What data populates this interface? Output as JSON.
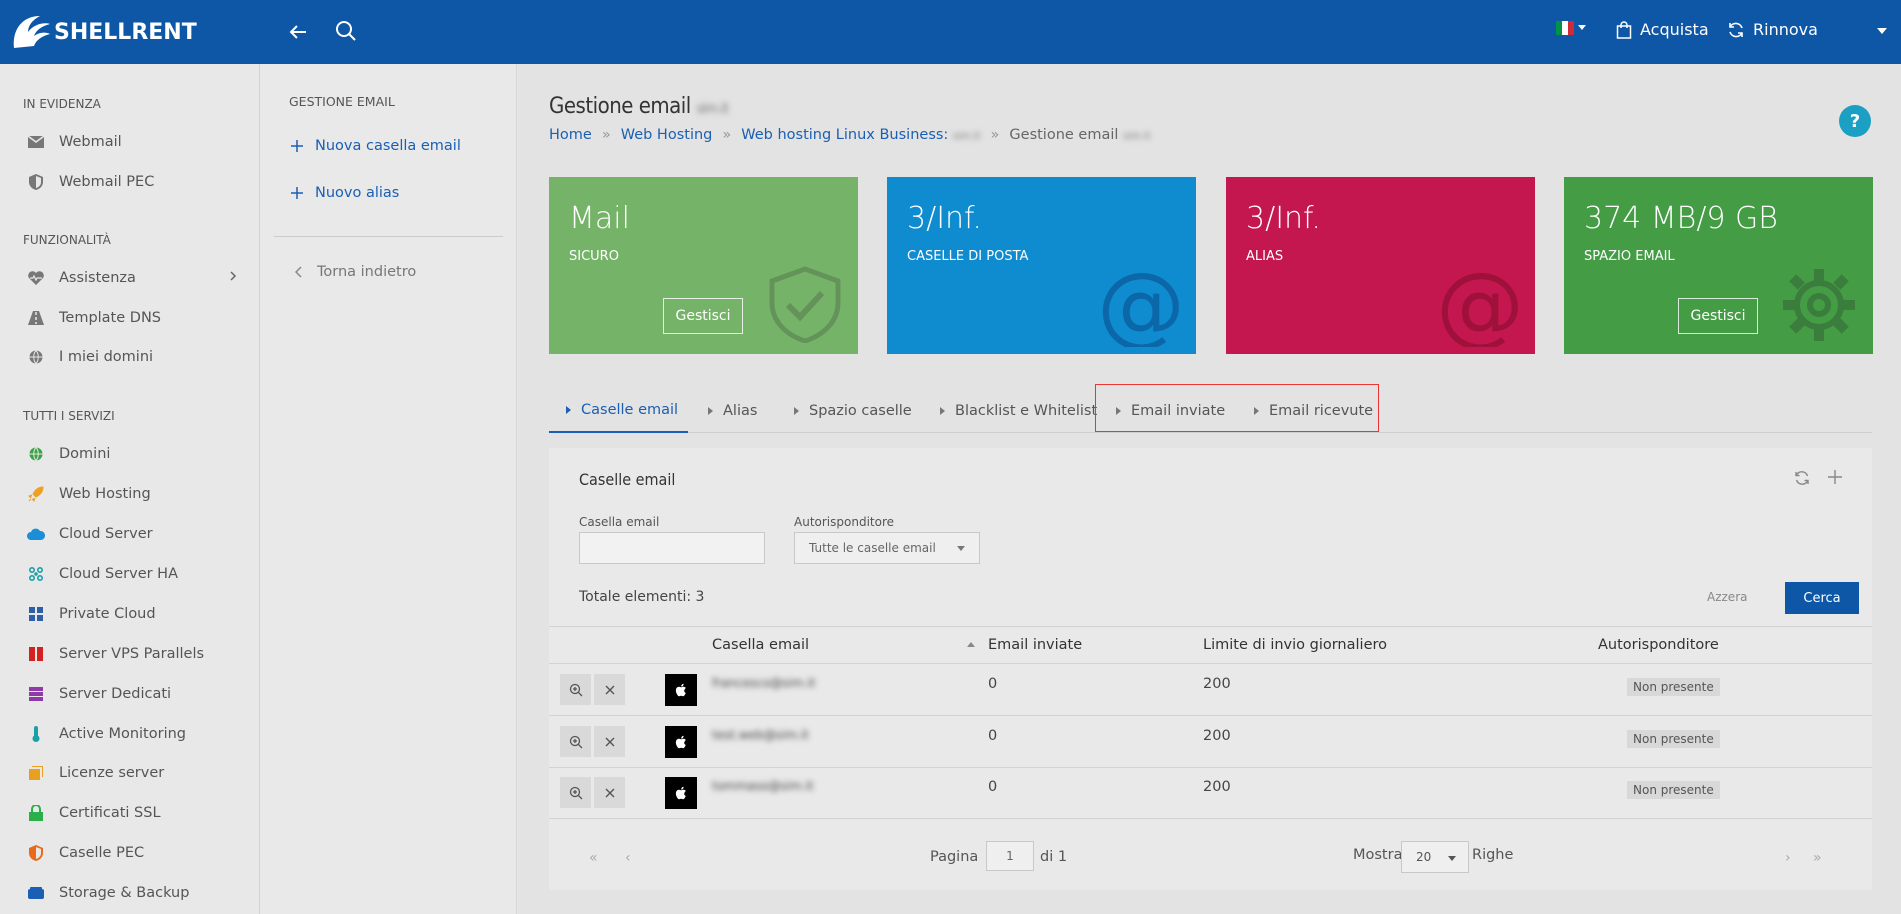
{
  "topbar": {
    "logo_text": "SHELLRENT",
    "acquista_label": "Acquista",
    "rinnova_label": "Rinnova"
  },
  "sidebar": {
    "sections": [
      {
        "title": "IN EVIDENZA"
      },
      {
        "title": "FUNZIONALITÀ"
      },
      {
        "title": "TUTTI I SERVIZI"
      }
    ],
    "items": [
      {
        "label": "Webmail",
        "icon": "envelope-icon"
      },
      {
        "label": "Webmail PEC",
        "icon": "shield-icon"
      },
      {
        "label": "Assistenza",
        "icon": "heart-pulse-icon"
      },
      {
        "label": "Template DNS",
        "icon": "road-icon"
      },
      {
        "label": "I miei domini",
        "icon": "globe-icon"
      },
      {
        "label": "Domini",
        "icon": "globe-icon"
      },
      {
        "label": "Web Hosting",
        "icon": "rocket-icon"
      },
      {
        "label": "Cloud Server",
        "icon": "cloud-icon"
      },
      {
        "label": "Cloud Server HA",
        "icon": "cluster-icon"
      },
      {
        "label": "Private Cloud",
        "icon": "grid-icon"
      },
      {
        "label": "Server VPS Parallels",
        "icon": "parallels-icon"
      },
      {
        "label": "Server Dedicati",
        "icon": "server-icon"
      },
      {
        "label": "Active Monitoring",
        "icon": "thermometer-icon"
      },
      {
        "label": "Licenze server",
        "icon": "license-icon"
      },
      {
        "label": "Certificati SSL",
        "icon": "lock-icon"
      },
      {
        "label": "Caselle PEC",
        "icon": "shield-icon"
      },
      {
        "label": "Storage & Backup",
        "icon": "storage-icon"
      }
    ]
  },
  "subnav": {
    "title": "GESTIONE EMAIL",
    "new_mailbox": "Nuova casella email",
    "new_alias": "Nuovo alias",
    "back": "Torna indietro"
  },
  "page": {
    "title": "Gestione email",
    "title_blurred": "sim.it",
    "breadcrumb": {
      "home": "Home",
      "hosting": "Web Hosting",
      "plan": "Web hosting Linux Business:",
      "plan_blurred": "sim.it",
      "current": "Gestione email",
      "current_blurred": "sim.it"
    }
  },
  "cards": [
    {
      "value": "Mail",
      "sub": "SICURO",
      "button": "Gestisci",
      "color": "#75b468"
    },
    {
      "value": "3/Inf.",
      "sub": "CASELLE DI POSTA",
      "color": "#0f8bd0"
    },
    {
      "value": "3/Inf.",
      "sub": "ALIAS",
      "color": "#c4174f"
    },
    {
      "value": "374 MB/9 GB",
      "sub": "SPAZIO EMAIL",
      "button": "Gestisci",
      "color": "#449c45"
    }
  ],
  "tabs": [
    "Caselle email",
    "Alias",
    "Spazio caselle",
    "Blacklist e Whitelist",
    "Email inviate",
    "Email ricevute"
  ],
  "panel": {
    "title": "Caselle email",
    "filter_mailbox_label": "Casella email",
    "filter_mailbox_value": "",
    "filter_autoresponder_label": "Autorisponditore",
    "filter_autoresponder_value": "Tutte le caselle email",
    "total": "Totale elementi: 3",
    "reset": "Azzera",
    "search": "Cerca",
    "columns": [
      "Casella email",
      "Email inviate",
      "Limite di invio giornaliero",
      "Autorisponditore"
    ],
    "rows": [
      {
        "email": "francesco@sim.it",
        "sent": "0",
        "limit": "200",
        "autoresponder": "Non presente"
      },
      {
        "email": "test.web@sim.it",
        "sent": "0",
        "limit": "200",
        "autoresponder": "Non presente"
      },
      {
        "email": "tommaso@sim.it",
        "sent": "0",
        "limit": "200",
        "autoresponder": "Non presente"
      }
    ],
    "pager": {
      "page_label": "Pagina",
      "page_value": "1",
      "of_label": "di 1",
      "show_label": "Mostra",
      "rows_value": "20",
      "rows_label": "Righe"
    }
  }
}
